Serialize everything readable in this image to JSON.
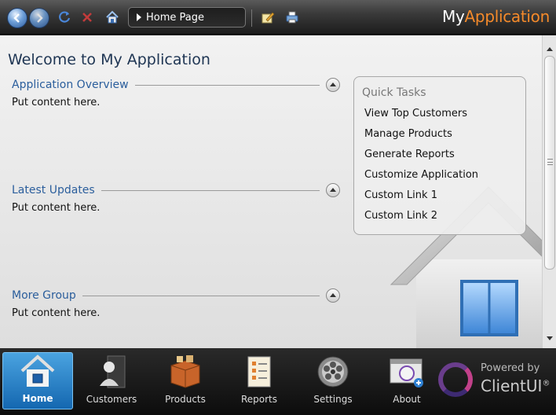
{
  "header": {
    "address": "Home Page",
    "brand_prefix": "My",
    "brand_accent": "Application",
    "accent_color": "#f58a2a"
  },
  "icons": [
    "back-icon",
    "forward-icon",
    "refresh-icon",
    "stop-icon",
    "home-icon",
    "edit-icon",
    "print-icon"
  ],
  "main": {
    "title": "Welcome to My Application",
    "groups": [
      {
        "title": "Application Overview",
        "body": "Put content here."
      },
      {
        "title": "Latest Updates",
        "body": "Put content here."
      },
      {
        "title": "More Group",
        "body": "Put content here."
      }
    ]
  },
  "quick_tasks": {
    "title": "Quick Tasks",
    "links": [
      "View Top Customers",
      "Manage Products",
      "Generate Reports",
      "Customize Application",
      "Custom Link 1",
      "Custom Link 2"
    ]
  },
  "dock": {
    "items": [
      {
        "label": "Home",
        "icon": "home-icon",
        "active": true
      },
      {
        "label": "Customers",
        "icon": "customers-icon",
        "active": false
      },
      {
        "label": "Products",
        "icon": "products-icon",
        "active": false
      },
      {
        "label": "Reports",
        "icon": "reports-icon",
        "active": false
      },
      {
        "label": "Settings",
        "icon": "settings-icon",
        "active": false
      },
      {
        "label": "About",
        "icon": "about-icon",
        "active": false
      }
    ],
    "powered_by": "Powered by",
    "powered_brand": "ClientUI",
    "powered_mark": "®"
  }
}
